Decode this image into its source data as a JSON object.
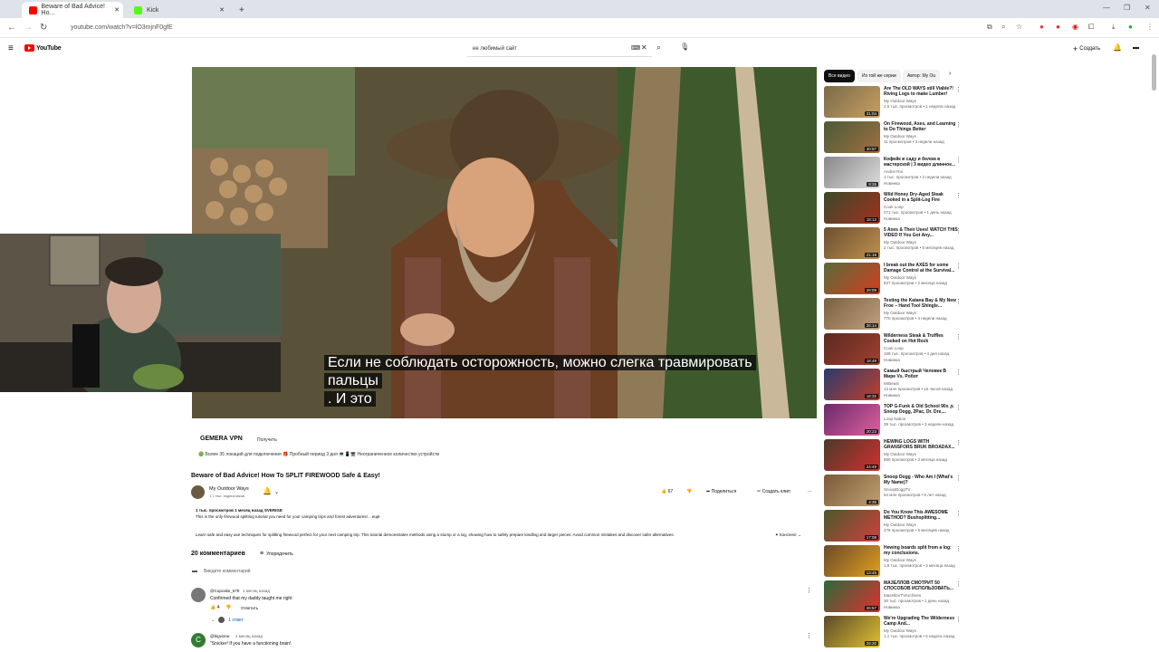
{
  "browser": {
    "tabs": [
      {
        "label": "Beware of Bad Advice! Ho...",
        "active": true,
        "favicon_color": "#ff0000"
      },
      {
        "label": "Kick",
        "active": false,
        "favicon_color": "#53fc18"
      }
    ],
    "url": "youtube.com/watch?v=lO3mjnF0gfE"
  },
  "youtube": {
    "logo": "YouTube",
    "search_value": "ее любимый сайт",
    "create_label": "Создать"
  },
  "video": {
    "subtitle_lines": [
      "Если не соблюдать осторожность, можно слегка травмировать",
      "пальцы",
      ". И это"
    ]
  },
  "ad": {
    "brand": "GEMERA VPN",
    "cta": "Получить",
    "features": "🟢 Более 35 локаций для подключения  🎁 Пробный период 3 дня  💻📱🖥 Неограниченное количество устройств"
  },
  "meta": {
    "title": "Beware of Bad Advice! How To SPLIT FIREWOOD Safe & Easy!",
    "channel": "My Outdoor Ways",
    "subscribers": "1,1 тыс. подписчиков",
    "likes": "67",
    "share_label": "Поделиться",
    "clip_label": "Создать клип",
    "views_line": "1 тыс. просмотров  1 месяц назад  SVERIGE",
    "desc_line1": "This is the only firewood splitting tutorial you need for your camping trips and forest adventures! ...ещё",
    "desc_line2": "Learn safe and easy axe techniques for splitting firewood perfect for your next camping trip. This tutorial demonstrates methods using a stump or a log, showing how to safely prepare kindling and larger pieces. Avoid common mistakes and discover safer alternatives.",
    "chapter_label": "Конспект"
  },
  "comments": {
    "count_label": "20 комментариев",
    "sort_label": "Упорядочить",
    "add_placeholder": "Введите комментарий",
    "items": [
      {
        "author": "@Cupcake_579",
        "time": "1 месяц назад",
        "text": "Confirmed that my daddy taught me right",
        "likes": "4",
        "reply": "Ответить",
        "replies": "1 ответ"
      },
      {
        "author": "@bigvione",
        "time": "1 месяц назад",
        "text": "\"Snicker! If you have a functioning brain!"
      }
    ]
  },
  "sidebar": {
    "chips": [
      "Все видео",
      "Из той же серии",
      "Автор: My Ou"
    ],
    "items": [
      {
        "title": "Are The OLD WAYS still Viable?! Riving Logs to make Lumber!",
        "channel": "My Outdoor Ways",
        "meta": "2,6 тыс. просмотров • 1 неделю назад",
        "dur": "31:04",
        "c1": "#7a6a4a",
        "c2": "#c8a060"
      },
      {
        "title": "On Firewood, Axes, and Learning to Do Things Better",
        "channel": "My Outdoor Ways",
        "meta": "11 просмотров • 3 недели назад",
        "dur": "30:57",
        "c1": "#4a5a3a",
        "c2": "#a07040"
      },
      {
        "title": "Кофейк в саду и белом в мастерской | 3 видео длинное...",
        "channel": "Andrei Roi",
        "meta": "1 тыс. просмотров • 2 недели назад",
        "badge": "Новинка",
        "dur": "9:26",
        "c1": "#888",
        "c2": "#ddd"
      },
      {
        "title": "Wild Honey Dry-Aged Steak Cooked in a Split-Log Fire",
        "channel": "Cook Loop",
        "meta": "271 тыс. просмотров • 1 день назад",
        "badge": "Новинка",
        "dur": "18:12",
        "c1": "#3a4a2a",
        "c2": "#a03020"
      },
      {
        "title": "5 Axes & Their Uses! WATCH THIS VIDEO If You Got Any...",
        "channel": "My Outdoor Ways",
        "meta": "2 тыс. просмотров • 5 месяцев назад",
        "dur": "21:18",
        "c1": "#6a5030",
        "c2": "#c09050"
      },
      {
        "title": "I break out the AXES for some Damage Control at the Survival...",
        "channel": "My Outdoor Ways",
        "meta": "827 просмотров • 2 месяца назад",
        "dur": "28:09",
        "c1": "#5a6a3a",
        "c2": "#d04020"
      },
      {
        "title": "Testing the Katana Bay & My New Froe – Hand Tool Shingle...",
        "channel": "My Outdoor Ways",
        "meta": "770 просмотров • 4 недели назад",
        "dur": "26:14",
        "c1": "#7a6040",
        "c2": "#c0a080"
      },
      {
        "title": "Wilderness Steak & Truffles Cooked on Hot Rock",
        "channel": "Cook Loop",
        "meta": "168 тыс. просмотров • 4 дня назад",
        "badge": "Новинка",
        "dur": "18:49",
        "c1": "#5a2a20",
        "c2": "#a04030"
      },
      {
        "title": "Самый быстрый Человек В Мире Vs. Робот",
        "channel": "MrBeast",
        "meta": "13 млн просмотров • 15 часов назад",
        "badge": "Новинка",
        "dur": "18:32",
        "c1": "#2a3a6a",
        "c2": "#c04030"
      },
      {
        "title": "TOP G-Funk & Old School 90s 🔊 Snoop Dogg, 2Pac, Dr. Dre,...",
        "channel": "Loop Nation",
        "meta": "39 тыс. просмотров • 3 недели назад",
        "dur": "20:23",
        "c1": "#6a2a6a",
        "c2": "#e060a0"
      },
      {
        "title": "HEWING LOGS WITH GRANSFORS BRUK BROADAX...",
        "channel": "My Outdoor Ways",
        "meta": "560 просмотров • 3 месяца назад",
        "dur": "24:49",
        "c1": "#4a3a2a",
        "c2": "#d03030"
      },
      {
        "title": "Snoop Dogg - Who Am I (What's My Name)?",
        "channel": "SnoopDoggTV",
        "meta": "54 млн просмотров • 8 лет назад",
        "dur": "4:35",
        "c1": "#7a5a3a",
        "c2": "#c0a070"
      },
      {
        "title": "Do You Know This AWESOME METHOD? Bushsplitting...",
        "channel": "My Outdoor Ways",
        "meta": "476 просмотров • 5 месяцев назад",
        "dur": "17:08",
        "c1": "#4a5a2a",
        "c2": "#d04040"
      },
      {
        "title": "Hewing boards split from a log: my conclusions.",
        "channel": "My Outdoor Ways",
        "meta": "1,8 тыс. просмотров • 3 месяца назад",
        "dur": "13:45",
        "c1": "#6a4a2a",
        "c2": "#e0a020"
      },
      {
        "title": "МАЗЕЛЛОВ СМОТРИТ 50 СПОСОБОВ ИСПОЛЬЗОВАТЬ...",
        "channel": "MazelloVTVArchives",
        "meta": "30 тыс. просмотров • 1 день назад",
        "badge": "Новинка",
        "dur": "26:57",
        "c1": "#2a6a3a",
        "c2": "#e03030"
      },
      {
        "title": "We're Upgrading The Wilderness Camp And...",
        "channel": "My Outdoor Ways",
        "meta": "1,1 тыс. просмотров • 5 недель назад",
        "dur": "26:20",
        "c1": "#5a4a2a",
        "c2": "#e0c030"
      }
    ]
  },
  "colors": {
    "accent": "#ff0000",
    "text": "#0f0f0f",
    "muted": "#606060"
  }
}
